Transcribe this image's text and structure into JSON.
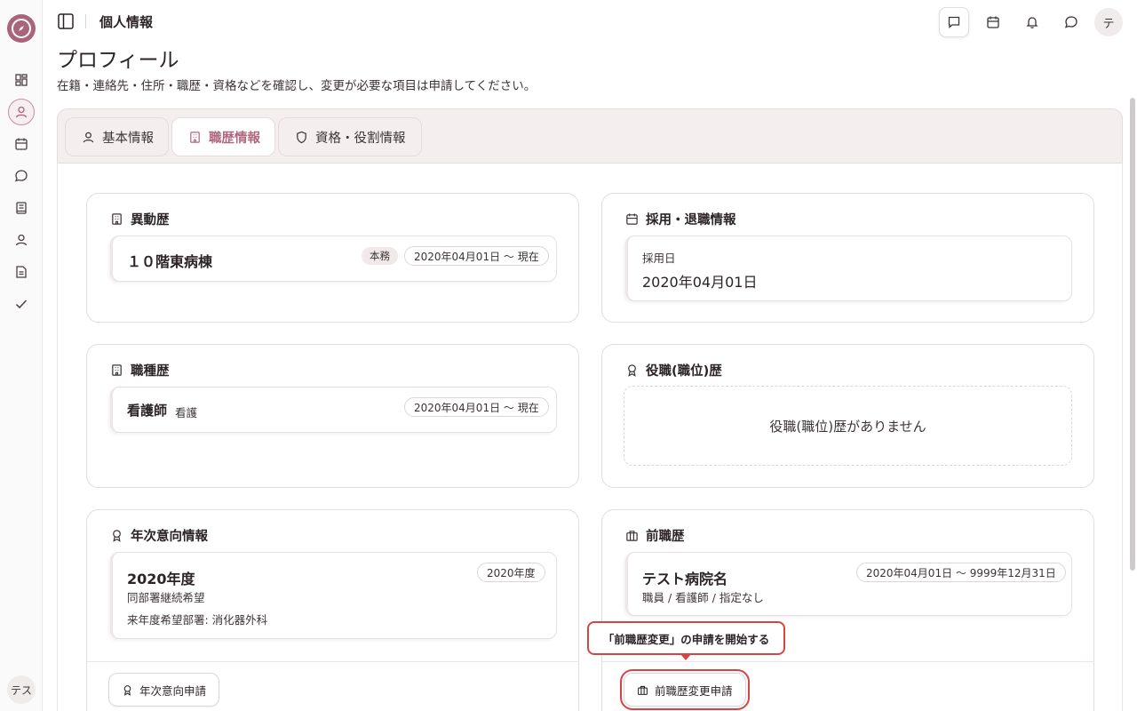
{
  "header": {
    "breadcrumb": "個人情報",
    "user_initial": "テ"
  },
  "sidebar": {
    "items": [
      {
        "icon": "dashboard-icon"
      },
      {
        "icon": "user-icon",
        "active": true
      },
      {
        "icon": "calendar-icon"
      },
      {
        "icon": "chat-icon"
      },
      {
        "icon": "book-icon"
      },
      {
        "icon": "person-icon"
      },
      {
        "icon": "document-icon"
      },
      {
        "icon": "check-icon"
      }
    ],
    "user_label": "テス"
  },
  "page": {
    "title": "プロフィール",
    "subtitle": "在籍・連絡先・住所・職歴・資格などを確認し、変更が必要な項目は申請してください。"
  },
  "tabs": [
    {
      "label": "基本情報",
      "icon": "person-icon"
    },
    {
      "label": "職歴情報",
      "icon": "building-icon",
      "active": true
    },
    {
      "label": "資格・役割情報",
      "icon": "shield-icon"
    }
  ],
  "transfer": {
    "title": "異動歴",
    "item": {
      "name": "１０階東病棟",
      "badge": "本務",
      "period": "2020年04月01日 〜 現在"
    }
  },
  "employment": {
    "title": "採用・退職情報",
    "hire_label": "採用日",
    "hire_date": "2020年04月01日"
  },
  "job_type": {
    "title": "職種歴",
    "item": {
      "name": "看護師",
      "category": "看護",
      "period": "2020年04月01日 〜 現在"
    }
  },
  "position": {
    "title": "役職(職位)歴",
    "empty": "役職(職位)歴がありません"
  },
  "annual": {
    "title": "年次意向情報",
    "item": {
      "year": "2020年度",
      "badge": "2020年度",
      "intent": "同部署継続希望",
      "next_dept": "来年度希望部署: 消化器外科"
    },
    "button": "年次意向申請"
  },
  "previous": {
    "title": "前職歴",
    "item": {
      "name": "テスト病院名",
      "period": "2020年04月01日 〜 9999年12月31日",
      "detail": "職員 / 看護師 / 指定なし"
    },
    "button": "前職歴変更申請",
    "tooltip": "「前職歴変更」の申請を開始する"
  },
  "colors": {
    "accent": "#b0687f",
    "highlight": "#d64545"
  }
}
